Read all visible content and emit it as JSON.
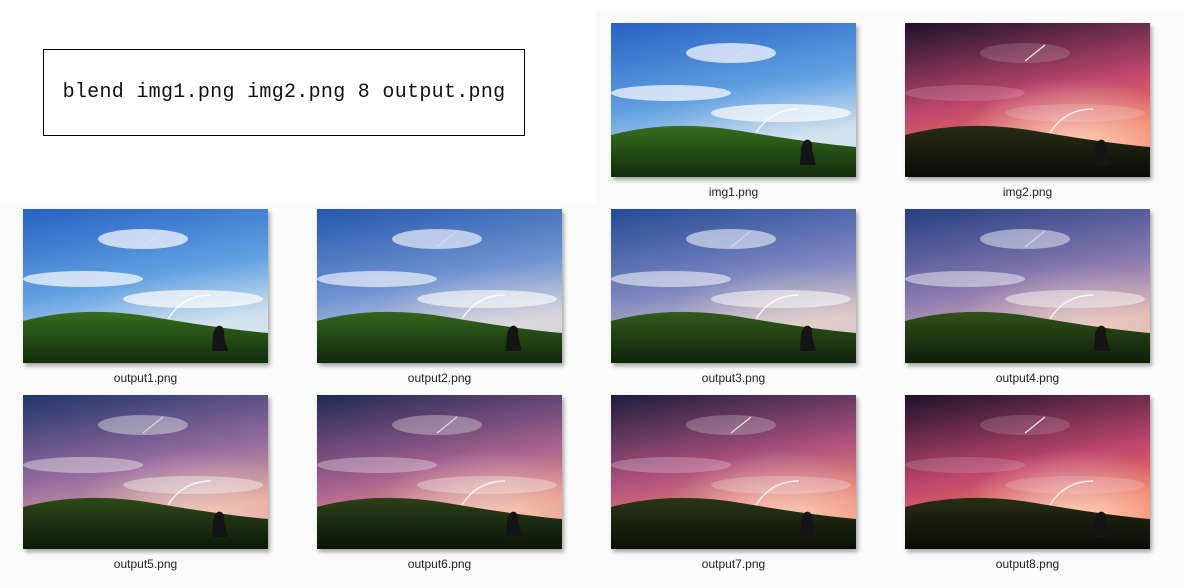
{
  "command": "blend img1.png img2.png 8 output.png",
  "files": [
    {
      "name": "img1.png",
      "mix": 0
    },
    {
      "name": "img2.png",
      "mix": 1
    },
    {
      "name": "output1.png",
      "mix": 0.0
    },
    {
      "name": "output2.png",
      "mix": 0.143
    },
    {
      "name": "output3.png",
      "mix": 0.286
    },
    {
      "name": "output4.png",
      "mix": 0.429
    },
    {
      "name": "output5.png",
      "mix": 0.571
    },
    {
      "name": "output6.png",
      "mix": 0.714
    },
    {
      "name": "output7.png",
      "mix": 0.857
    },
    {
      "name": "output8.png",
      "mix": 1.0
    }
  ]
}
